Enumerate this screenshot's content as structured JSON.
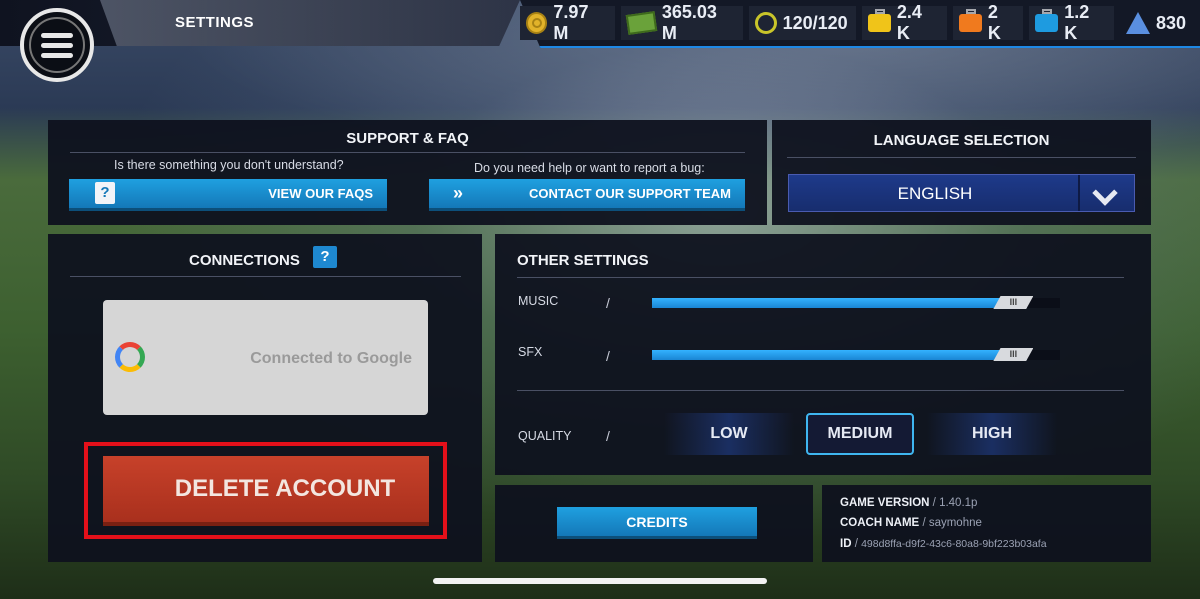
{
  "header": {
    "title": "SETTINGS",
    "currencies": [
      {
        "icon": "coin-icon",
        "value": "7.97 M"
      },
      {
        "icon": "cash-icon",
        "value": "365.03 M"
      },
      {
        "icon": "stopwatch-icon",
        "value": "120/120"
      },
      {
        "icon": "yellow-case-icon",
        "value": "2.4 K"
      },
      {
        "icon": "orange-case-icon",
        "value": "2 K"
      },
      {
        "icon": "blue-case-icon",
        "value": "1.2 K"
      },
      {
        "icon": "triangle-icon",
        "value": "830"
      }
    ]
  },
  "support": {
    "title": "SUPPORT & FAQ",
    "faq_question": "Is there something you don't understand?",
    "faq_button": "VIEW OUR FAQS",
    "help_question": "Do you need help or want to report a bug:",
    "help_button": "CONTACT OUR SUPPORT TEAM"
  },
  "language": {
    "title": "LANGUAGE SELECTION",
    "selected": "ENGLISH"
  },
  "connections": {
    "title": "CONNECTIONS",
    "help_glyph": "?",
    "google_status": "Connected to Google",
    "delete_button": "DELETE ACCOUNT"
  },
  "other_settings": {
    "title": "OTHER SETTINGS",
    "music_label": "MUSIC",
    "music_level": 0.92,
    "sfx_label": "SFX",
    "sfx_level": 0.92,
    "slider_grip": "III",
    "separator": "/",
    "quality_label": "QUALITY",
    "quality_options": [
      "LOW",
      "MEDIUM",
      "HIGH"
    ],
    "quality_selected": "MEDIUM"
  },
  "footer": {
    "credits_button": "CREDITS",
    "game_version_key": "GAME VERSION",
    "game_version": "1.40.1p",
    "coach_name_key": "COACH NAME",
    "coach_name": "saymohne",
    "id_key": "ID",
    "id": "498d8ffa-d9f2-43c6-80a8-9bf223b03afa"
  },
  "colors": {
    "accent_blue": "#1fa0e0",
    "delete_red": "#c7412a",
    "highlight_red": "#e4101a"
  }
}
